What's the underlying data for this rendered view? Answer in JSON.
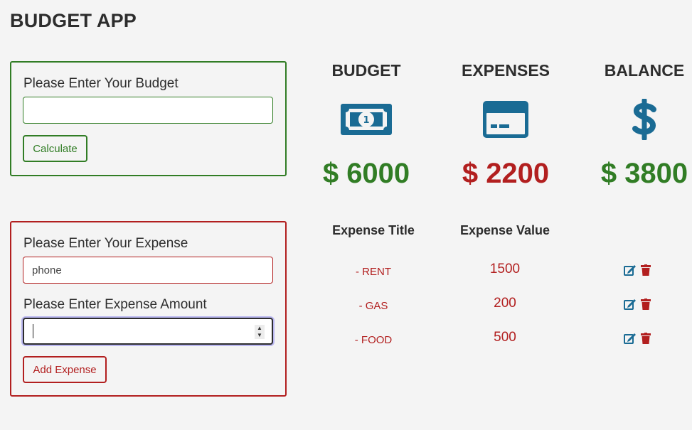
{
  "app": {
    "title": "BUDGET APP"
  },
  "budget_form": {
    "label": "Please Enter Your Budget",
    "input_value": "",
    "button_label": "Calculate"
  },
  "expense_form": {
    "title_label": "Please Enter Your Expense",
    "title_value": "phone",
    "amount_label": "Please Enter Expense Amount",
    "amount_value": "",
    "button_label": "Add Expense"
  },
  "summary": {
    "budget": {
      "title": "BUDGET",
      "amount": "$ 6000",
      "icon": "money-bill-icon"
    },
    "expenses": {
      "title": "EXPENSES",
      "amount": "$ 2200",
      "icon": "credit-card-icon"
    },
    "balance": {
      "title": "BALANCE",
      "amount": "$ 3800",
      "icon": "dollar-sign-icon"
    }
  },
  "expense_list": {
    "headers": [
      "Expense Title",
      "Expense Value"
    ],
    "items": [
      {
        "title": "- RENT",
        "value": "1500"
      },
      {
        "title": "- GAS",
        "value": "200"
      },
      {
        "title": "- FOOD",
        "value": "500"
      }
    ]
  },
  "colors": {
    "green": "#317d25",
    "red": "#b21f1f",
    "icon_blue": "#1a6b94",
    "background": "#f4f4f4"
  }
}
